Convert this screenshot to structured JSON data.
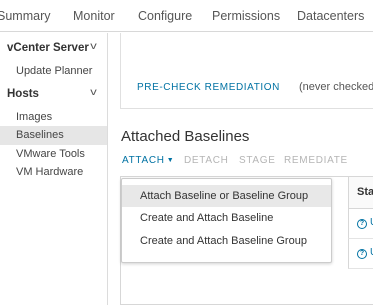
{
  "tabs": [
    {
      "label": "Summary"
    },
    {
      "label": "Monitor"
    },
    {
      "label": "Configure"
    },
    {
      "label": "Permissions"
    },
    {
      "label": "Datacenters"
    }
  ],
  "sidebar": {
    "groups": [
      {
        "label": "vCenter Server",
        "expanded": true,
        "items": [
          {
            "label": "Update Planner"
          }
        ]
      },
      {
        "label": "Hosts",
        "expanded": true,
        "items": [
          {
            "label": "Images"
          },
          {
            "label": "Baselines",
            "selected": true
          },
          {
            "label": "VMware Tools"
          },
          {
            "label": "VM Hardware"
          }
        ]
      }
    ]
  },
  "precheck": {
    "link_label": "PRE-CHECK REMEDIATION",
    "status": "(never checked)"
  },
  "attached_baselines": {
    "title": "Attached Baselines",
    "actions": {
      "attach": "ATTACH",
      "detach": "DETACH",
      "stage": "STAGE",
      "remediate": "REMEDIATE"
    },
    "table": {
      "visible_header": "Stat",
      "rows": [
        {
          "status": "U"
        },
        {
          "status": "U"
        }
      ]
    }
  },
  "attach_menu": {
    "items": [
      {
        "label": "Attach Baseline or Baseline Group",
        "hovered": true
      },
      {
        "label": "Create and Attach Baseline"
      },
      {
        "label": "Create and Attach Baseline Group"
      }
    ]
  },
  "colors": {
    "link": "#0072a3",
    "disabled": "#b5b5b5",
    "selected_bg": "#e6e6e6"
  }
}
